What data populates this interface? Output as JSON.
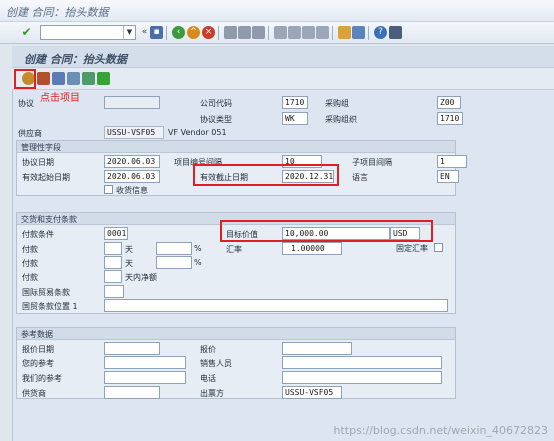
{
  "window_title": "创建 合同：抬头数据",
  "screen_title": "创建 合同：抬头数据",
  "annotation": "点击项目",
  "header": {
    "agreement_label": "协议",
    "company_code_label": "公司代码",
    "company_code": "1710",
    "purch_group_label": "采购组",
    "purch_group": "Z00",
    "agreement_type_label": "协议类型",
    "agreement_type": "WK",
    "purch_org_label": "采购组织",
    "purch_org": "1710",
    "vendor_label": "供应商",
    "vendor": "USSU-VSF05",
    "vendor_name": "VF Vendor 051"
  },
  "admin": {
    "title": "管理性字段",
    "agreement_date_label": "协议日期",
    "agreement_date": "2020.06.03",
    "item_interval_label": "项目编号间隔",
    "item_interval": "10",
    "subitem_interval_label": "子项目间隔",
    "subitem_interval": "1",
    "valid_from_label": "有效起始日期",
    "valid_from": "2020.06.03",
    "valid_to_label": "有效截止日期",
    "valid_to": "2020.12.31",
    "language_label": "语言",
    "language": "EN",
    "gr_label": "收货信息"
  },
  "terms": {
    "title": "交货和支付条款",
    "payment_terms_label": "付款条件",
    "payment_terms": "0001",
    "target_value_label": "目标价值",
    "target_value": "10,000.00",
    "currency": "USD",
    "payment_label": "付款",
    "days_label": "天",
    "pct": "%",
    "exchange_rate_label": "汇率",
    "exchange_rate": "1.00000",
    "fixed_rate_label": "固定汇率",
    "net_days_label": "天内净额",
    "incoterms_label": "国际贸易条款",
    "incoterms_loc_label": "国贸条款位置 1"
  },
  "reference": {
    "title": "参考数据",
    "quotation_date_label": "报价日期",
    "quotation_label": "报价",
    "your_ref_label": "您的参考",
    "salesperson_label": "销售人员",
    "our_ref_label": "我们的参考",
    "phone_label": "电话",
    "supplier_label": "供货商",
    "invoicing_party_label": "出票方",
    "invoicing_party": "USSU-VSF05"
  },
  "watermark": "https://blog.csdn.net/weixin_40672823",
  "colors": {
    "highlight": "#e02020",
    "sap_bg": "#dfe6ee"
  }
}
